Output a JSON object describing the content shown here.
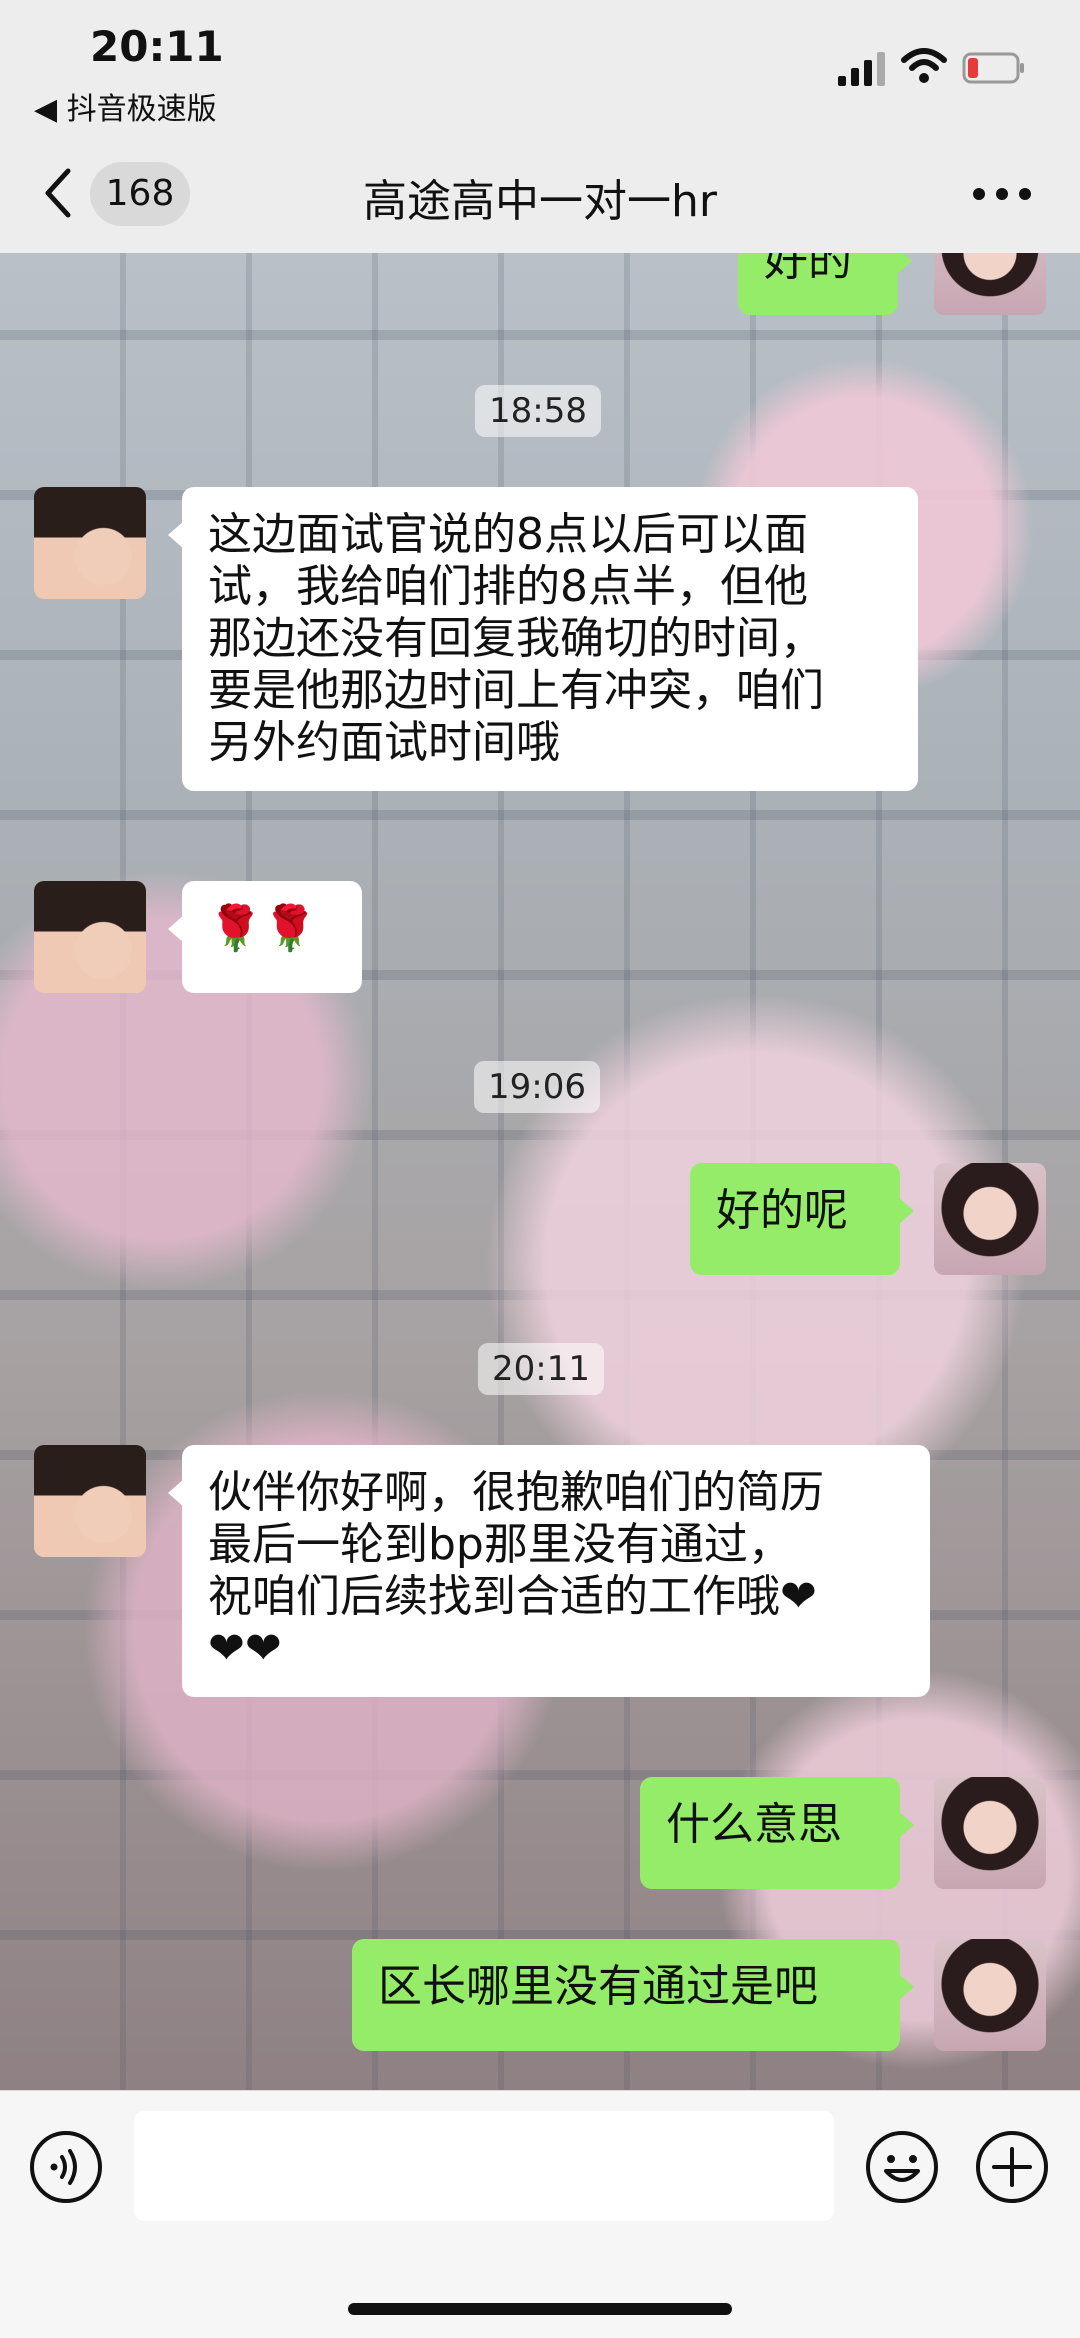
{
  "status": {
    "time": "20:11",
    "back_app": "◀ 抖音极速版"
  },
  "nav": {
    "unread_count": "168",
    "title": "高途高中一对一hr"
  },
  "messages": [
    {
      "type": "outgoing",
      "text": "好的"
    },
    {
      "type": "timestamp",
      "text": "18:58"
    },
    {
      "type": "incoming",
      "lines": [
        "这边面试官说的8点以后可以面",
        "试，我给咱们排的8点半，但他",
        "那边还没有回复我确切的时间，",
        "要是他那边时间上有冲突，咱们",
        "另外约面试时间哦"
      ]
    },
    {
      "type": "incoming",
      "text": "🌹🌹"
    },
    {
      "type": "timestamp",
      "text": "19:06"
    },
    {
      "type": "outgoing",
      "text": "好的呢"
    },
    {
      "type": "timestamp",
      "text": "20:11"
    },
    {
      "type": "incoming",
      "lines": [
        "伙伴你好啊，很抱歉咱们的简历",
        "最后一轮到bp那里没有通过，",
        "祝咱们后续找到合适的工作哦❤",
        "❤❤"
      ]
    },
    {
      "type": "outgoing",
      "text": "什么意思"
    },
    {
      "type": "outgoing",
      "text": "区长哪里没有通过是吧"
    }
  ],
  "input": {
    "placeholder": ""
  },
  "icons": {
    "voice": "voice-icon",
    "emoji": "emoji-icon",
    "plus": "plus-icon",
    "back": "chevron-left-icon",
    "more": "more-icon"
  },
  "colors": {
    "outgoing_bubble": "#95ec69",
    "incoming_bubble": "#ffffff",
    "background": "#ededed"
  }
}
